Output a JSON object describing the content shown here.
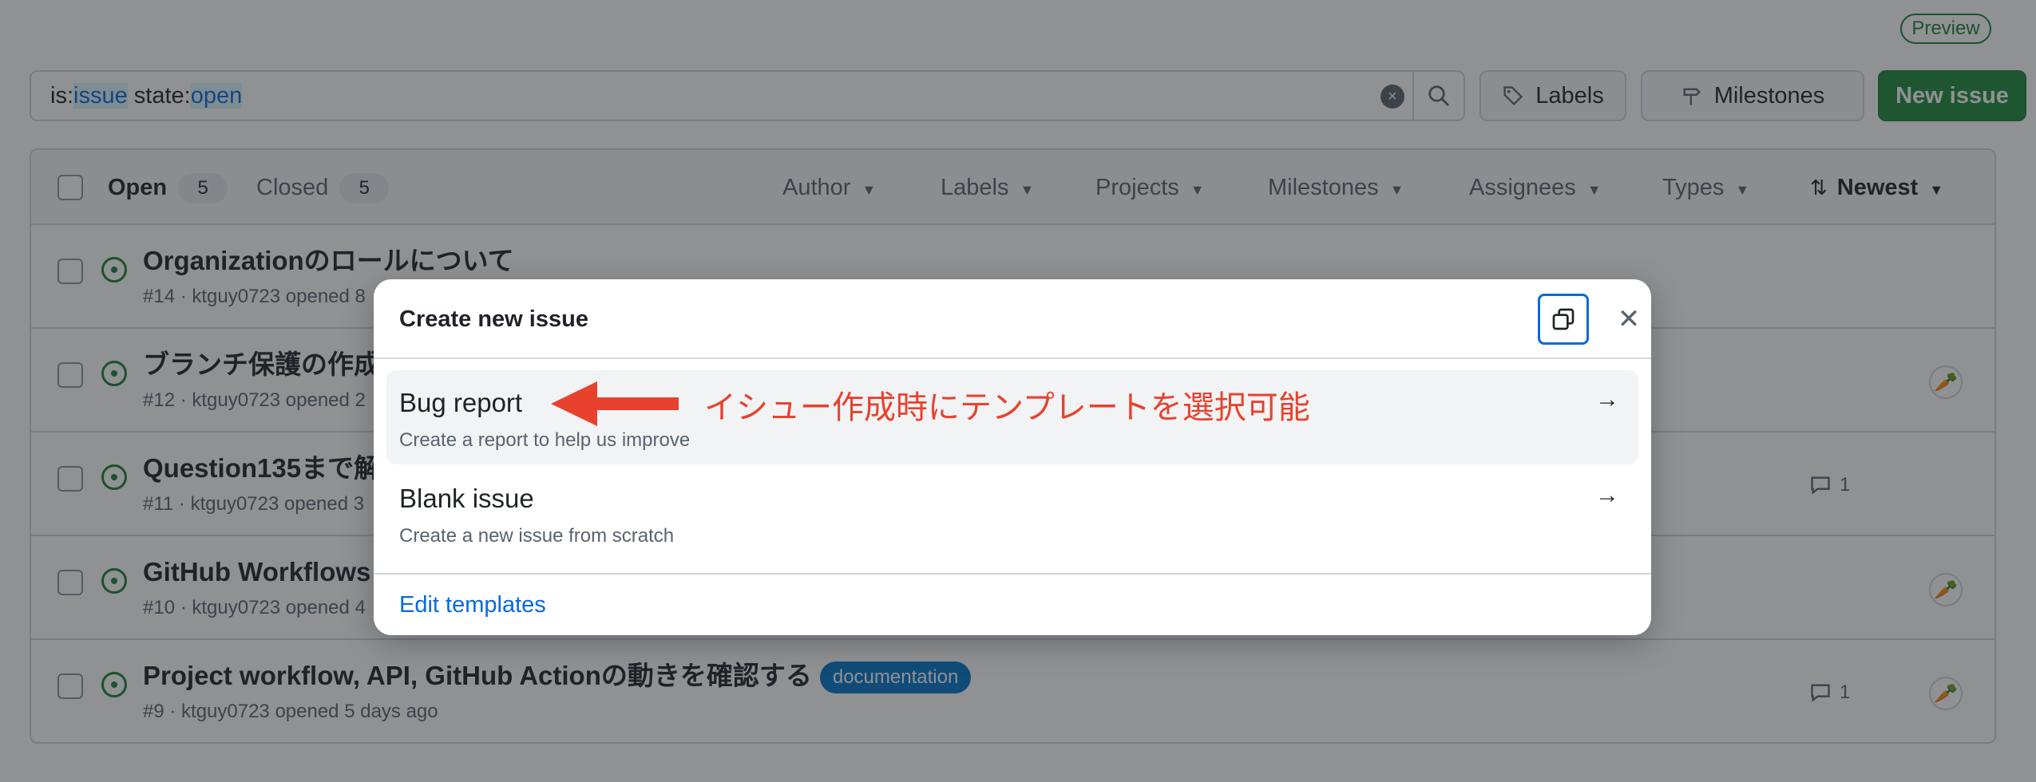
{
  "header": {
    "preview_badge": "Preview",
    "search": {
      "qualifier1_key": "is:",
      "qualifier1_val": "issue",
      "qualifier2_key": "state:",
      "qualifier2_val": "open"
    },
    "labels_button": "Labels",
    "milestones_button": "Milestones",
    "new_issue_button": "New issue"
  },
  "list_header": {
    "open_label": "Open",
    "open_count": "5",
    "closed_label": "Closed",
    "closed_count": "5",
    "filters": {
      "author": "Author",
      "labels": "Labels",
      "projects": "Projects",
      "milestones": "Milestones",
      "assignees": "Assignees",
      "types": "Types",
      "sort": "Newest"
    }
  },
  "issues": [
    {
      "title": "Organizationのロールについて",
      "meta": "#14 · ktguy0723 opened 8"
    },
    {
      "title": "ブランチ保護の作成",
      "meta": "#12 · ktguy0723 opened 2"
    },
    {
      "title": "Question135まで解",
      "meta": "#11 · ktguy0723 opened 3",
      "comments": "1"
    },
    {
      "title": "GitHub Workflowsと",
      "meta": "#10 · ktguy0723 opened 4"
    },
    {
      "title": "Project workflow, API, GitHub Actionの動きを確認する",
      "label": "documentation",
      "meta": "#9 · ktguy0723 opened 5 days ago",
      "comments": "1"
    }
  ],
  "dialog": {
    "title": "Create new issue",
    "templates": [
      {
        "name": "Bug report",
        "description": "Create a report to help us improve"
      },
      {
        "name": "Blank issue",
        "description": "Create a new issue from scratch"
      }
    ],
    "edit_templates": "Edit templates"
  },
  "annotation": {
    "text": "イシュー作成時にテンプレートを選択可能",
    "color": "#e8422e"
  },
  "colors": {
    "accent": "#0969da",
    "success": "#1f883d",
    "label_documentation": "#0075ca"
  }
}
